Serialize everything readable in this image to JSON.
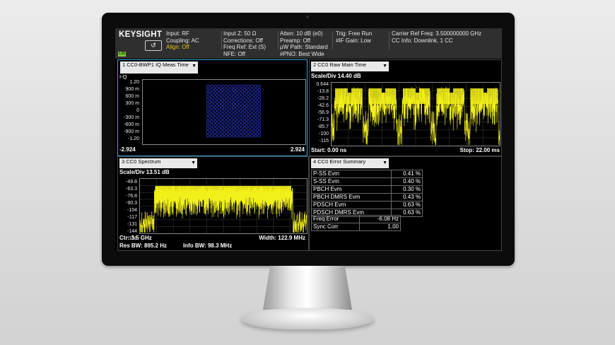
{
  "header": {
    "logo": "KEYSIGHT",
    "logo_icon": "return-arrow-icon",
    "lxi": "LXI",
    "col1": [
      "Input: RF",
      "Coupling: AC",
      "Align: Off"
    ],
    "col2": [
      "Input Z: 50 Ω",
      "Corrections: Off",
      "Freq Ref: Ext (S)",
      "NFE: Off"
    ],
    "col3": [
      "Atten: 10 dB (e0)",
      "Preamp: Off",
      "µW Path: Standard",
      "#PNO: Best Wide"
    ],
    "col4": [
      "Trig: Free Run",
      "#IF Gain: Low"
    ],
    "col5": [
      "Carrier Ref Freq: 3.500000000 GHz",
      "CC Info: Downlink, 1 CC"
    ],
    "align_color": "#e6c619"
  },
  "pane1": {
    "title": "1 CC0-BWP1 IQ Meas Time",
    "axis_label": "I-Q",
    "yticks": [
      "1.20",
      "900 m",
      "600 m",
      "300 m",
      "0",
      "-300 m",
      "-600 m",
      "-900 m",
      "-1.20"
    ],
    "x_left": "-2.924",
    "x_right": "2.924"
  },
  "pane2": {
    "title": "2 CC0 Raw Main Time",
    "scale": "Scale/Div 14.40 dB",
    "yticks": [
      "0.644",
      "-13.8",
      "-28.2",
      "-42.6",
      "-56.9",
      "-71.3",
      "-85.7",
      "-100",
      "-115"
    ],
    "start": "Start: 0.00 ns",
    "stop": "Stop: 22.00 ms"
  },
  "pane3": {
    "title": "3 CC0 Spectrum",
    "scale": "Scale/Div 13.51 dB",
    "yticks": [
      "-49.8",
      "-63.3",
      "-76.8",
      "-90.3",
      "-104",
      "-117",
      "-131",
      "-144",
      "-158"
    ],
    "ctr": "Ctr: 3.5 GHz",
    "width": "Width: 122.9 MHz",
    "res_bw": "Res BW: 895.2 Hz",
    "info_bw": "Info BW: 98.3 MHz"
  },
  "pane4": {
    "title": "4 CC0 Error Summary",
    "rows": [
      {
        "name": "P-SS Evm",
        "value": "0.41 %"
      },
      {
        "name": "S-SS Evm",
        "value": "0.40 %"
      },
      {
        "name": "PBCH Evm",
        "value": "0.30 %"
      },
      {
        "name": "PBCH DMRS Evm",
        "value": "0.43 %"
      },
      {
        "name": "PDSCH Evm",
        "value": "0.63 %"
      },
      {
        "name": "PDSCH DMRS Evm",
        "value": "0.63 %"
      }
    ],
    "extra": [
      {
        "name": "Freq Error",
        "value": "-6.08 Hz"
      },
      {
        "name": "Sync Corr",
        "value": "1.00"
      }
    ]
  },
  "colors": {
    "trace": "#f2ef1a",
    "constellation": "#2b3bd6",
    "active_border": "#3aa4d8"
  }
}
